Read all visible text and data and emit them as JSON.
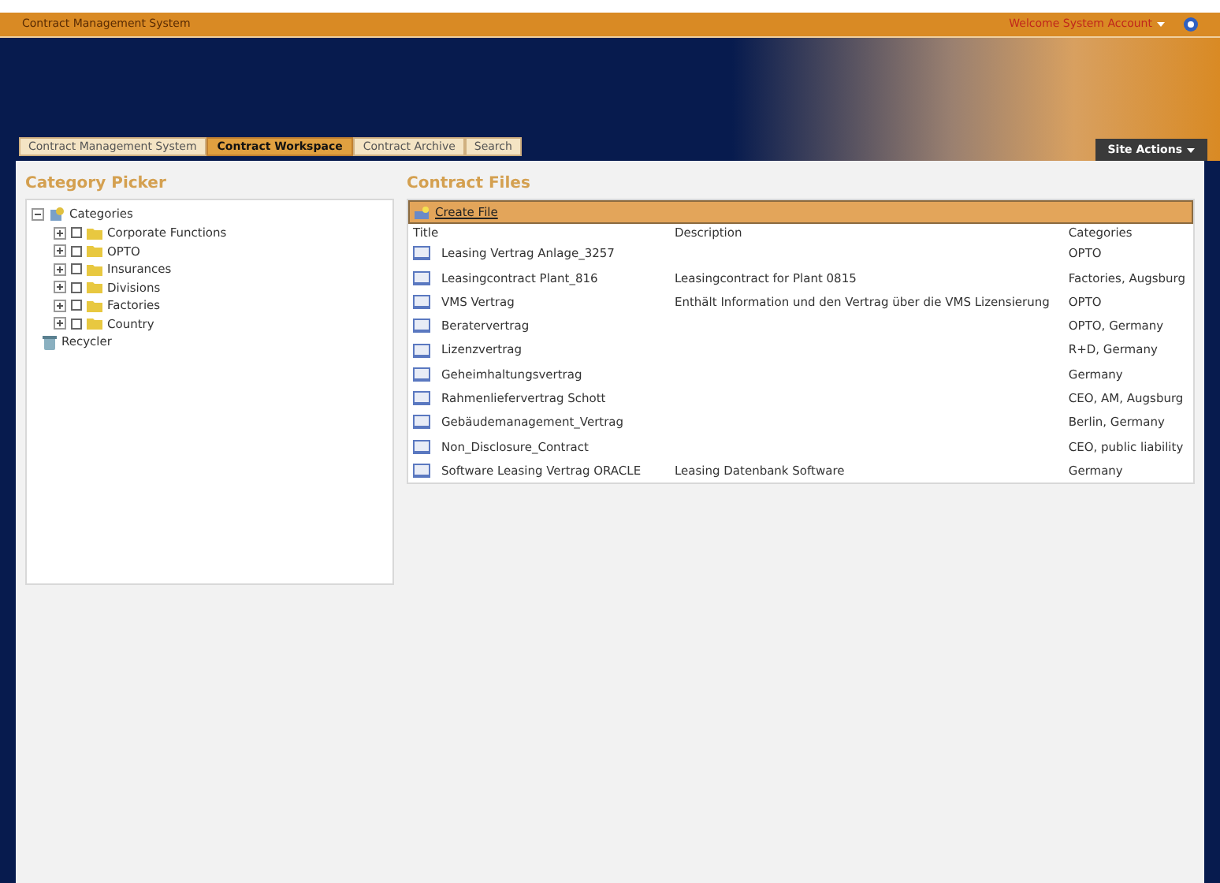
{
  "top_bar": {
    "title": "Contract Management System",
    "welcome": "Welcome System Account"
  },
  "tabs": [
    {
      "label": "Contract Management System",
      "selected": false
    },
    {
      "label": "Contract Workspace",
      "selected": true
    },
    {
      "label": "Contract Archive",
      "selected": false
    },
    {
      "label": "Search",
      "selected": false
    }
  ],
  "site_actions": "Site Actions",
  "category_picker": {
    "title": "Category Picker",
    "root": {
      "label": "Categories",
      "expanded": true,
      "children": [
        {
          "label": "Corporate Functions",
          "checked": false,
          "expanded": false
        },
        {
          "label": "OPTO",
          "checked": false,
          "expanded": false
        },
        {
          "label": "Insurances",
          "checked": false,
          "expanded": false
        },
        {
          "label": "Divisions",
          "checked": false,
          "expanded": false
        },
        {
          "label": "Factories",
          "checked": false,
          "expanded": false
        },
        {
          "label": "Country",
          "checked": false,
          "expanded": false
        }
      ]
    },
    "recycler": "Recycler"
  },
  "contract_files": {
    "title": "Contract Files",
    "create": "Create File",
    "columns": [
      "Title",
      "Description",
      "Categories"
    ],
    "rows": [
      [
        "Leasing Vertrag Anlage_3257",
        "",
        "OPTO"
      ],
      [
        "Leasingcontract Plant_816",
        "Leasingcontract for Plant 0815",
        "Factories, Augsburg"
      ],
      [
        "VMS Vertrag",
        "Enthält Information und den Vertrag über die VMS Lizensierung",
        "OPTO"
      ],
      [
        "Beratervertrag",
        "",
        "OPTO, Germany"
      ],
      [
        "Lizenzvertrag",
        "",
        "R+D, Germany"
      ],
      [
        "Geheimhaltungsvertrag",
        "",
        "Germany"
      ],
      [
        "Rahmenliefervertrag Schott",
        "",
        "CEO, AM, Augsburg"
      ],
      [
        "Gebäudemanagement_Vertrag",
        "",
        "Berlin, Germany"
      ],
      [
        "Non_Disclosure_Contract",
        "",
        "CEO, public liability"
      ],
      [
        "Software Leasing Vertrag ORACLE",
        "Leasing Datenbank Software",
        "Germany"
      ]
    ]
  }
}
